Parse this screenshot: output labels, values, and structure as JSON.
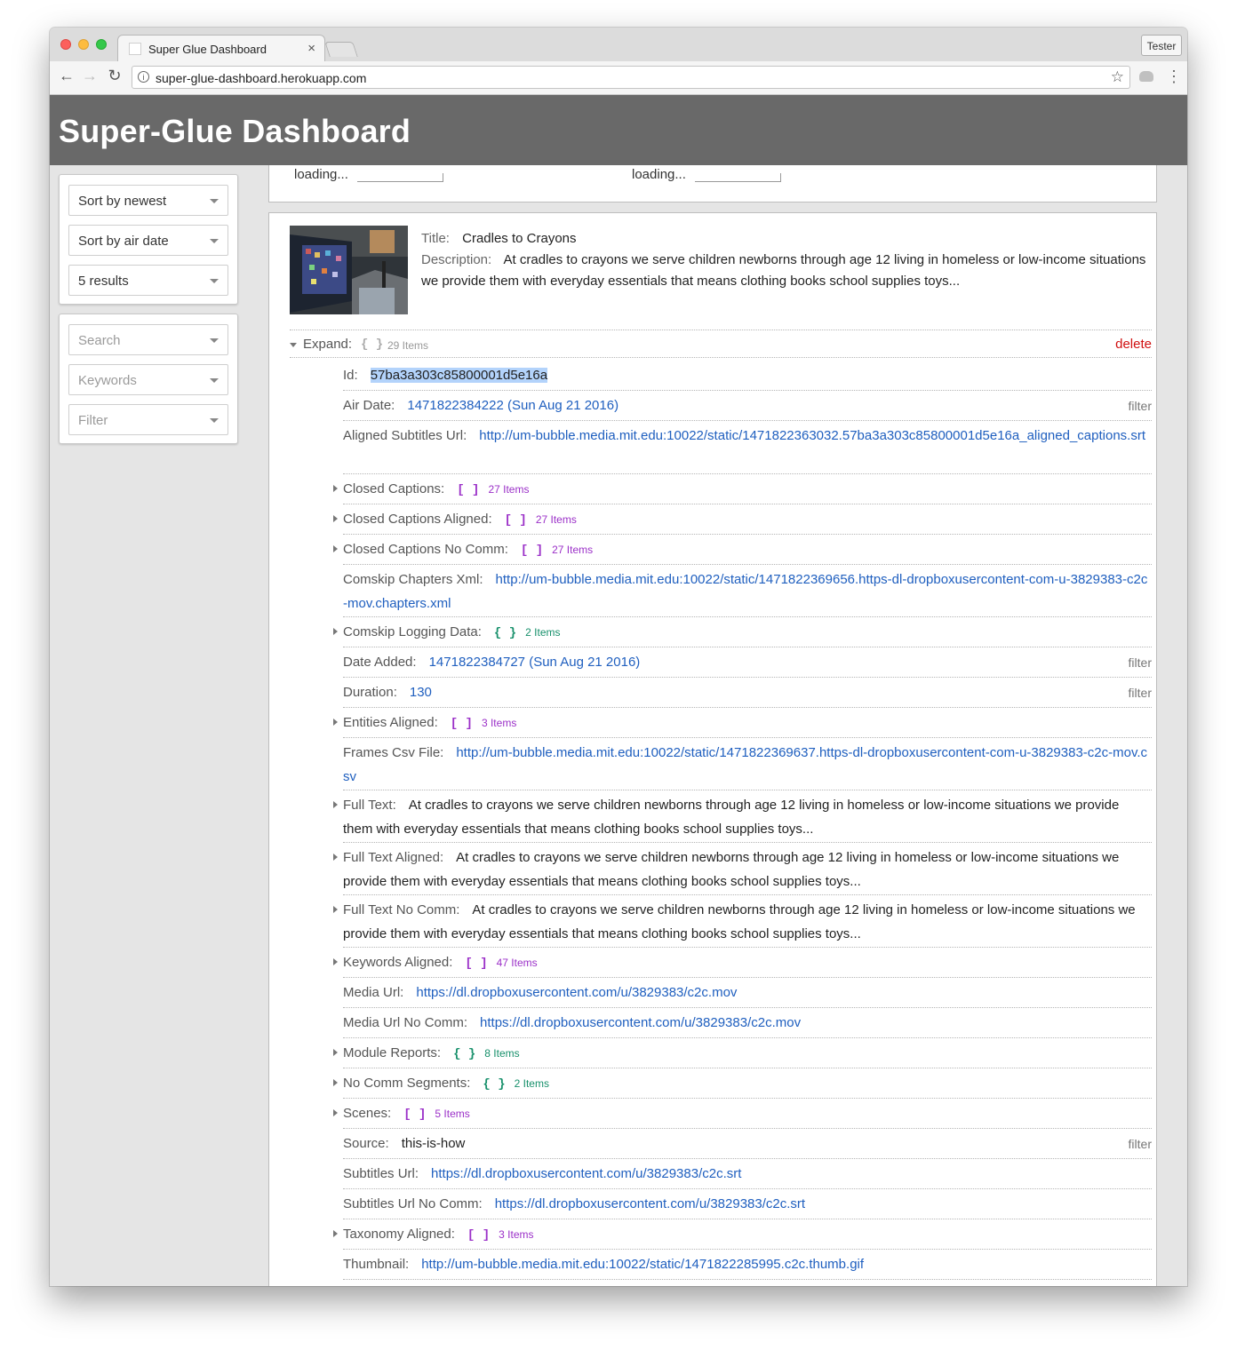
{
  "browser": {
    "tab_title": "Super Glue Dashboard",
    "tab_close": "×",
    "profile": "Tester",
    "url": "super-glue-dashboard.herokuapp.com",
    "info_glyph": "i",
    "back_glyph": "←",
    "forward_glyph": "→",
    "reload_glyph": "↻",
    "star_glyph": "☆",
    "menu_glyph": "⋮"
  },
  "header": {
    "title": "Super-Glue Dashboard"
  },
  "sidebar": {
    "sort_newest": "Sort by newest",
    "sort_air": "Sort by air date",
    "results": "5 results",
    "search_placeholder": "Search",
    "keywords_placeholder": "Keywords",
    "filter_placeholder": "Filter"
  },
  "top_card": {
    "loading_left": "loading...",
    "loading_right": "loading..."
  },
  "item": {
    "title_label": "Title:",
    "title": "Cradles to Crayons",
    "description_label": "Description:",
    "description": "At cradles to crayons we serve children newborns through age 12 living in homeless or low-income situations we provide them with everyday essentials that means clothing books school supplies toys...",
    "expand_label": "Expand:",
    "expand_brackets": "{ }",
    "expand_count": "29 Items",
    "delete_label": "delete",
    "filter_label": "filter"
  },
  "fields": [
    {
      "label": "Id:",
      "value": "57ba3a303c85800001d5e16a",
      "kind": "id"
    },
    {
      "label": "Air Date:",
      "value": "1471822384222 (Sun Aug 21 2016)",
      "kind": "link",
      "filter": true
    },
    {
      "label": "Aligned Subtitles Url:",
      "value": "http://um-bubble.media.mit.edu:10022/static/1471822363032.57ba3a303c85800001d5e16a_aligned_captions.srt",
      "kind": "link"
    },
    {
      "label": "Closed Captions:",
      "brackets": "[ ]",
      "count": "27 Items",
      "kind": "arr"
    },
    {
      "label": "Closed Captions Aligned:",
      "brackets": "[ ]",
      "count": "27 Items",
      "kind": "arr"
    },
    {
      "label": "Closed Captions No Comm:",
      "brackets": "[ ]",
      "count": "27 Items",
      "kind": "arr"
    },
    {
      "label": "Comskip Chapters Xml:",
      "value": "http://um-bubble.media.mit.edu:10022/static/1471822369656.https-dl-dropboxusercontent-com-u-3829383-c2c-mov.chapters.xml",
      "kind": "link"
    },
    {
      "label": "Comskip Logging Data:",
      "brackets": "{ }",
      "count": "2 Items",
      "kind": "obj"
    },
    {
      "label": "Date Added:",
      "value": "1471822384727 (Sun Aug 21 2016)",
      "kind": "link",
      "filter": true
    },
    {
      "label": "Duration:",
      "value": "130",
      "kind": "link",
      "filter": true
    },
    {
      "label": "Entities Aligned:",
      "brackets": "[ ]",
      "count": "3 Items",
      "kind": "arr"
    },
    {
      "label": "Frames Csv File:",
      "value": "http://um-bubble.media.mit.edu:10022/static/1471822369637.https-dl-dropboxusercontent-com-u-3829383-c2c-mov.csv",
      "kind": "link"
    },
    {
      "label": "Full Text:",
      "value": "At cradles to crayons we serve children newborns through age 12 living in homeless or low-income situations we provide them with everyday essentials that means clothing books school supplies toys...",
      "kind": "text"
    },
    {
      "label": "Full Text Aligned:",
      "value": "At cradles to crayons we serve children newborns through age 12 living in homeless or low-income situations we provide them with everyday essentials that means clothing books school supplies toys...",
      "kind": "text"
    },
    {
      "label": "Full Text No Comm:",
      "value": "At cradles to crayons we serve children newborns through age 12 living in homeless or low-income situations we provide them with everyday essentials that means clothing books school supplies toys...",
      "kind": "text"
    },
    {
      "label": "Keywords Aligned:",
      "brackets": "[ ]",
      "count": "47 Items",
      "kind": "arr"
    },
    {
      "label": "Media Url:",
      "value": "https://dl.dropboxusercontent.com/u/3829383/c2c.mov",
      "kind": "link"
    },
    {
      "label": "Media Url No Comm:",
      "value": "https://dl.dropboxusercontent.com/u/3829383/c2c.mov",
      "kind": "link"
    },
    {
      "label": "Module Reports:",
      "brackets": "{ }",
      "count": "8 Items",
      "kind": "obj"
    },
    {
      "label": "No Comm Segments:",
      "brackets": "{ }",
      "count": "2 Items",
      "kind": "obj"
    },
    {
      "label": "Scenes:",
      "brackets": "[ ]",
      "count": "5 Items",
      "kind": "arr"
    },
    {
      "label": "Source:",
      "value": "this-is-how",
      "kind": "plain",
      "filter": true
    },
    {
      "label": "Subtitles Url:",
      "value": "https://dl.dropboxusercontent.com/u/3829383/c2c.srt",
      "kind": "link"
    },
    {
      "label": "Subtitles Url No Comm:",
      "value": "https://dl.dropboxusercontent.com/u/3829383/c2c.srt",
      "kind": "link"
    },
    {
      "label": "Taxonomy Aligned:",
      "brackets": "[ ]",
      "count": "3 Items",
      "kind": "arr"
    },
    {
      "label": "Thumbnail:",
      "value": "http://um-bubble.media.mit.edu:10022/static/1471822285995.c2c.thumb.gif",
      "kind": "link"
    }
  ],
  "colors": {
    "header_bg": "#696969",
    "link": "#1f5fbf",
    "array": "#9b30c8",
    "object": "#17906b",
    "delete": "#d01010"
  }
}
